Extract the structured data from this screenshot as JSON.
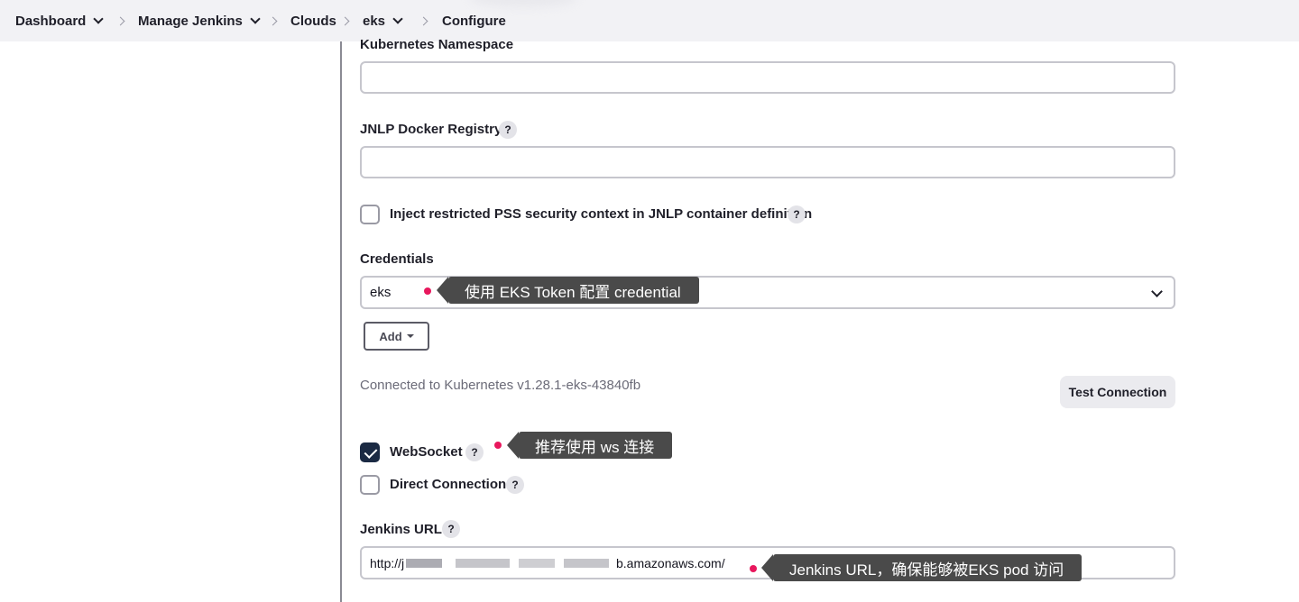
{
  "breadcrumb": {
    "items": [
      {
        "label": "Dashboard"
      },
      {
        "label": "Manage Jenkins"
      },
      {
        "label": "Clouds"
      },
      {
        "label": "eks"
      },
      {
        "label": "Configure"
      }
    ]
  },
  "form": {
    "namespace": {
      "label": "Kubernetes Namespace",
      "value": ""
    },
    "jnlp_registry": {
      "label": "JNLP Docker Registry",
      "value": ""
    },
    "inject_pss": {
      "label": "Inject restricted PSS security context in JNLP container definition",
      "checked": false
    },
    "credentials": {
      "label": "Credentials",
      "selected": "eks",
      "add_label": "Add"
    },
    "connection": {
      "status": "Connected to Kubernetes v1.28.1-eks-43840fb",
      "test_label": "Test Connection"
    },
    "websocket": {
      "label": "WebSocket",
      "checked": true
    },
    "direct_connection": {
      "label": "Direct Connection",
      "checked": false
    },
    "jenkins_url": {
      "label": "Jenkins URL",
      "value_prefix": "http://j",
      "value_suffix": "b.amazonaws.com/"
    },
    "help_glyph": "?"
  },
  "annotations": {
    "credential": "使用 EKS Token 配置 credential",
    "websocket": "推荐使用 ws 连接",
    "jenkins_url": "Jenkins URL，确保能够被EKS pod 访问"
  },
  "colors": {
    "annotation_bg": "#4a4a4a",
    "annotation_dot": "#e8175d",
    "checkbox_checked": "#1b2a43"
  }
}
